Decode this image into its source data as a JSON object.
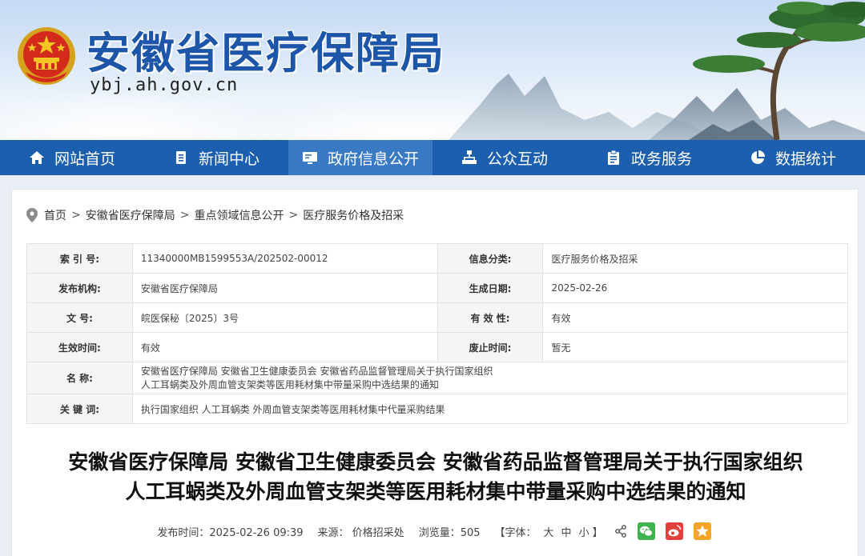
{
  "header": {
    "title": "安徽省医疗保障局",
    "domain": "ybj.ah.gov.cn"
  },
  "nav": {
    "items": [
      {
        "label": "网站首页",
        "icon": "home-icon"
      },
      {
        "label": "新闻中心",
        "icon": "document-icon"
      },
      {
        "label": "政府信息公开",
        "icon": "monitor-icon",
        "active": true
      },
      {
        "label": "公众互动",
        "icon": "org-chart-icon"
      },
      {
        "label": "政务服务",
        "icon": "clipboard-icon"
      },
      {
        "label": "数据统计",
        "icon": "pie-chart-icon"
      }
    ]
  },
  "breadcrumb": [
    "首页",
    "安徽省医疗保障局",
    "重点领域信息公开",
    "医疗服务价格及招采"
  ],
  "breadcrumb_sep": ">",
  "meta": {
    "index_label": "索 引 号:",
    "index_value": "11340000MB1599553A/202502-00012",
    "category_label": "信息分类:",
    "category_value": "医疗服务价格及招采",
    "publisher_label": "发布机构:",
    "publisher_value": "安徽省医疗保障局",
    "date_label": "生成日期:",
    "date_value": "2025-02-26",
    "docno_label": "文 号:",
    "docno_value": "皖医保秘〔2025〕3号",
    "validity_label": "有 效 性:",
    "validity_value": "有效",
    "effective_label": "生效时间:",
    "effective_value": "有效",
    "expire_label": "废止时间:",
    "expire_value": "暂无",
    "name_label": "名 称:",
    "name_line1": "安徽省医疗保障局 安徽省卫生健康委员会 安徽省药品监督管理局关于执行国家组织",
    "name_line2": "人工耳蜗类及外周血管支架类等医用耗材集中带量采购中选结果的通知",
    "keywords_label": "关 键 词:",
    "keywords_value": "执行国家组织 人工耳蜗类 外周血管支架类等医用耗材集中代量采购结果"
  },
  "article": {
    "title_line1": "安徽省医疗保障局 安徽省卫生健康委员会 安徽省药品监督管理局关于执行国家组织",
    "title_line2": "人工耳蜗类及外周血管支架类等医用耗材集中带量采购中选结果的通知",
    "publish_time": "发布时间：2025-02-26 09:39",
    "source": "来源： 价格招采处",
    "views": "浏览量：505",
    "font_prefix": "【字体：",
    "font_large": "大",
    "font_medium": "中",
    "font_small": "小",
    "font_suffix": "】"
  },
  "colors": {
    "nav_bg": "#1b5fae",
    "nav_active": "#3a7ac4",
    "title_blue": "#1d56a8",
    "wechat": "#3fb34f",
    "weibo": "#e2403c",
    "favorite": "#f5a623"
  }
}
